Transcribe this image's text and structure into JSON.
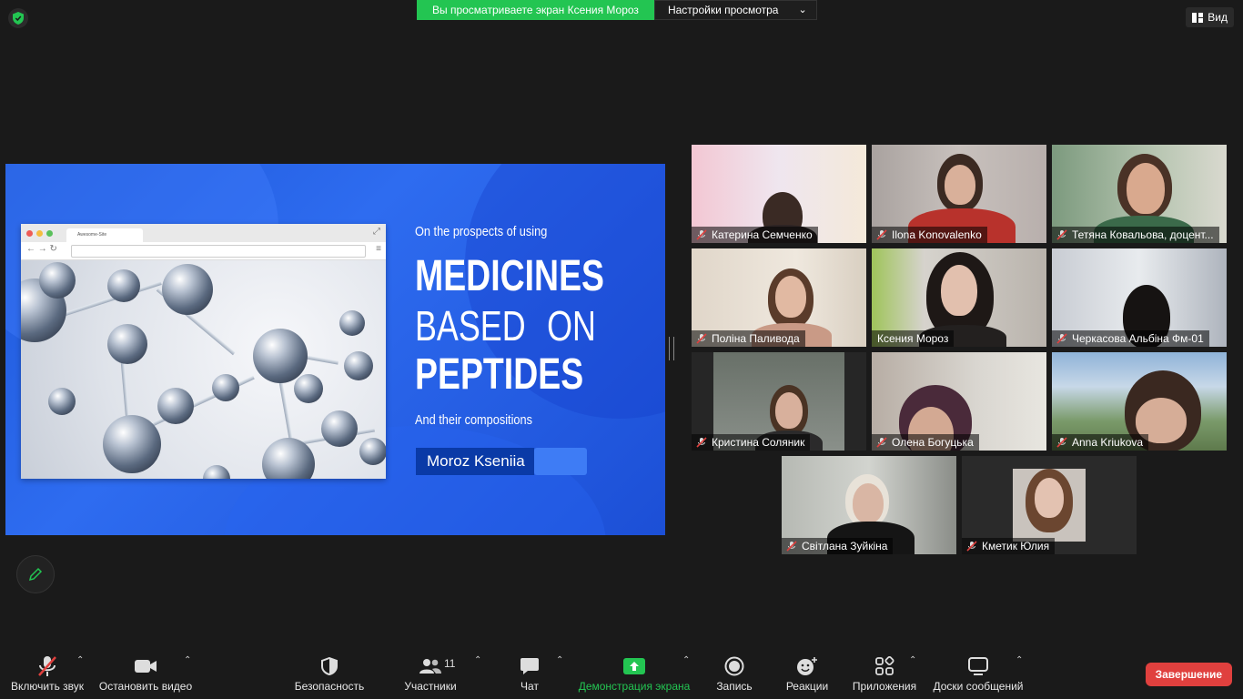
{
  "banner": {
    "sharing_text": "Вы просматриваете экран Ксения Мороз",
    "view_settings": "Настройки просмотра",
    "view_button": "Вид"
  },
  "slide": {
    "browser_tab": "Awesome-Site",
    "subtitle": "On the prospects of using",
    "title_line1": "MEDICINES",
    "title_line2_a": "BASED",
    "title_line2_b": "ON",
    "title_line3": "PEPTIDES",
    "subtitle2": "And their compositions",
    "author": "Moroz Kseniia"
  },
  "participants": [
    {
      "name": "Катерина Семченко",
      "muted": true
    },
    {
      "name": "Ilona Konovalenko",
      "muted": true
    },
    {
      "name": "Тетяна Ковальова, доцент...",
      "muted": true
    },
    {
      "name": "Поліна Паливода",
      "muted": true
    },
    {
      "name": "Ксения Мороз",
      "muted": false,
      "active_speaker": true
    },
    {
      "name": "Черкасова Альбіна Фм-01",
      "muted": true
    },
    {
      "name": "Кристина Соляник",
      "muted": true
    },
    {
      "name": "Олена Богуцька",
      "muted": true
    },
    {
      "name": "Anna Kriukova",
      "muted": true
    },
    {
      "name": "Світлана Зуйкіна",
      "muted": true
    },
    {
      "name": "Кметик Юлия",
      "muted": true
    }
  ],
  "toolbar": {
    "mute": "Включить звук",
    "video": "Остановить видео",
    "security": "Безопасность",
    "participants": "Участники",
    "participants_count": "11",
    "chat": "Чат",
    "share": "Демонстрация экрана",
    "record": "Запись",
    "reactions": "Реакции",
    "apps": "Приложения",
    "whiteboards": "Доски сообщений",
    "end": "Завершение"
  },
  "colors": {
    "share_green": "#23c552",
    "end_red": "#e0403e",
    "active_speaker": "#c9f05a",
    "slide_blue": "#2e6cf0"
  }
}
